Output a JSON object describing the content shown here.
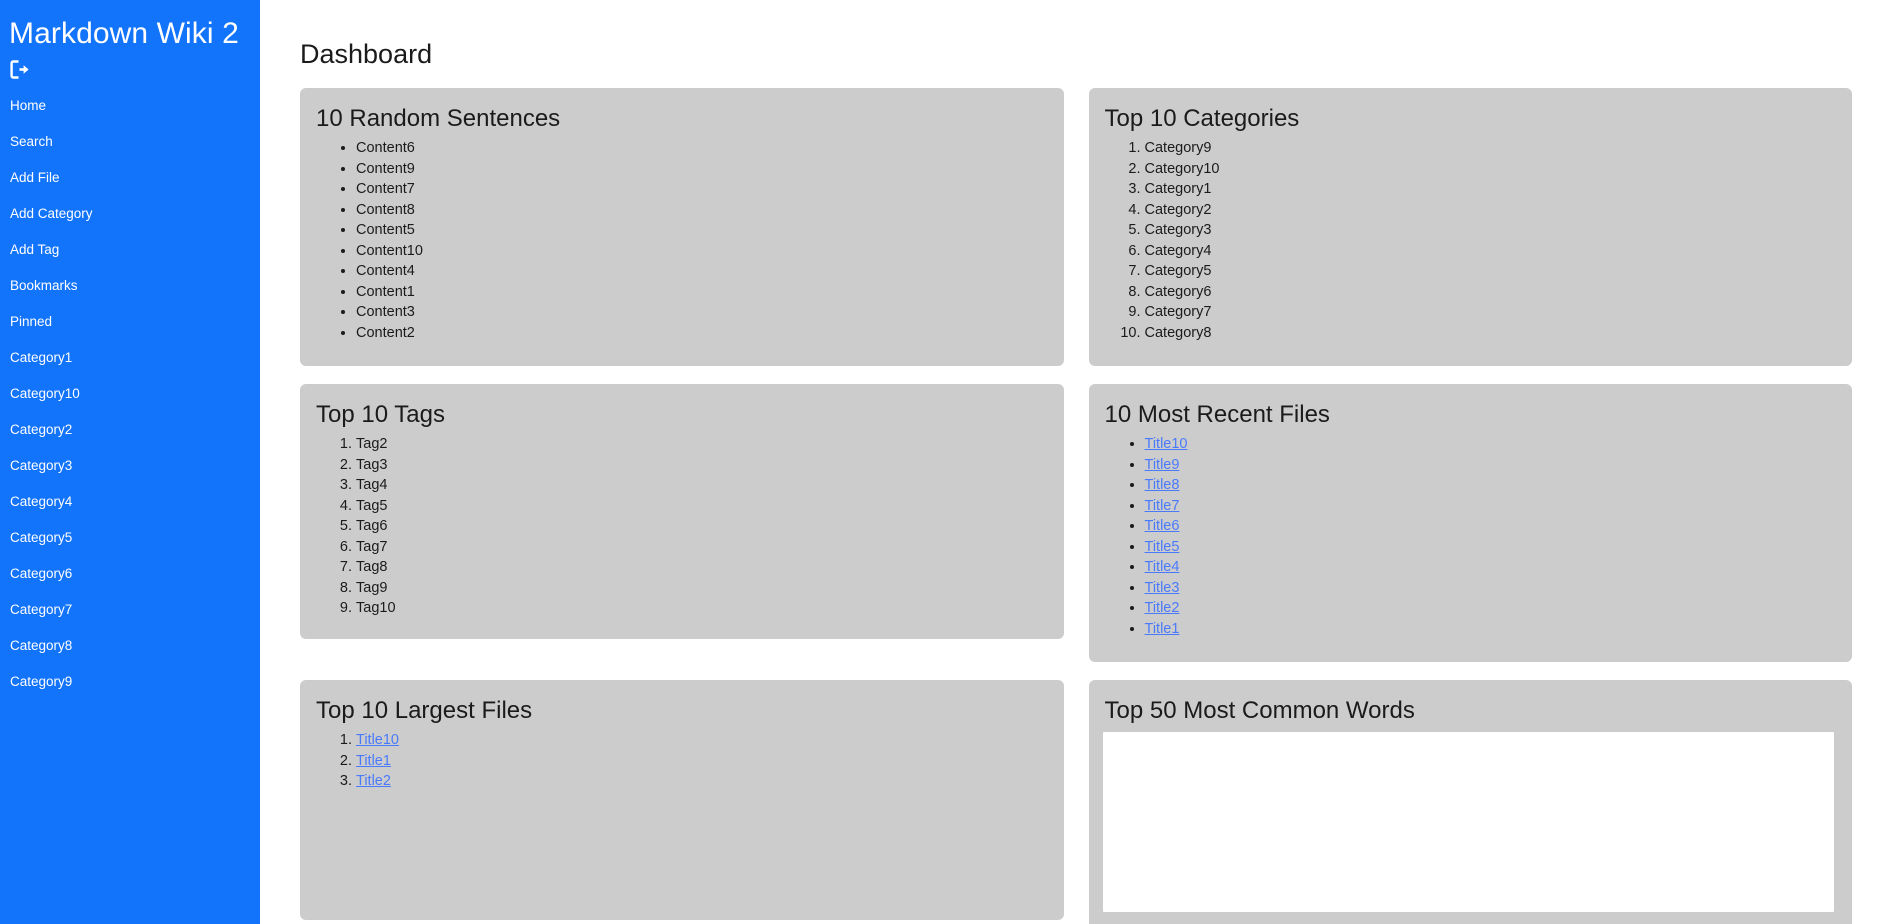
{
  "sidebar": {
    "brand": "Markdown Wiki 2",
    "logout_icon": "logout-icon",
    "items": [
      {
        "label": "Home"
      },
      {
        "label": "Search"
      },
      {
        "label": "Add File"
      },
      {
        "label": "Add Category"
      },
      {
        "label": "Add Tag"
      },
      {
        "label": "Bookmarks"
      },
      {
        "label": "Pinned"
      },
      {
        "label": "Category1"
      },
      {
        "label": "Category10"
      },
      {
        "label": "Category2"
      },
      {
        "label": "Category3"
      },
      {
        "label": "Category4"
      },
      {
        "label": "Category5"
      },
      {
        "label": "Category6"
      },
      {
        "label": "Category7"
      },
      {
        "label": "Category8"
      },
      {
        "label": "Category9"
      }
    ]
  },
  "main": {
    "page_title": "Dashboard",
    "cards": {
      "sentences": {
        "title": "10 Random Sentences",
        "items": [
          "Content6",
          "Content9",
          "Content7",
          "Content8",
          "Content5",
          "Content10",
          "Content4",
          "Content1",
          "Content3",
          "Content2"
        ]
      },
      "categories": {
        "title": "Top 10 Categories",
        "items": [
          "Category9",
          "Category10",
          "Category1",
          "Category2",
          "Category3",
          "Category4",
          "Category5",
          "Category6",
          "Category7",
          "Category8"
        ]
      },
      "tags": {
        "title": "Top 10 Tags",
        "items": [
          "Tag2",
          "Tag3",
          "Tag4",
          "Tag5",
          "Tag6",
          "Tag7",
          "Tag8",
          "Tag9",
          "Tag10"
        ]
      },
      "recent_files": {
        "title": "10 Most Recent Files",
        "items": [
          "Title10",
          "Title9",
          "Title8",
          "Title7",
          "Title6",
          "Title5",
          "Title4",
          "Title3",
          "Title2",
          "Title1"
        ]
      },
      "largest_files": {
        "title": "Top 10 Largest Files",
        "items": [
          "Title10",
          "Title1",
          "Title2"
        ]
      },
      "common_words": {
        "title": "Top 50 Most Common Words",
        "wordcloud": ""
      }
    }
  },
  "colors": {
    "sidebar_bg": "#1273fb",
    "card_bg": "#cccccc",
    "link": "#4a7afc",
    "text": "#1b1b1b",
    "page_bg": "#ffffff"
  }
}
